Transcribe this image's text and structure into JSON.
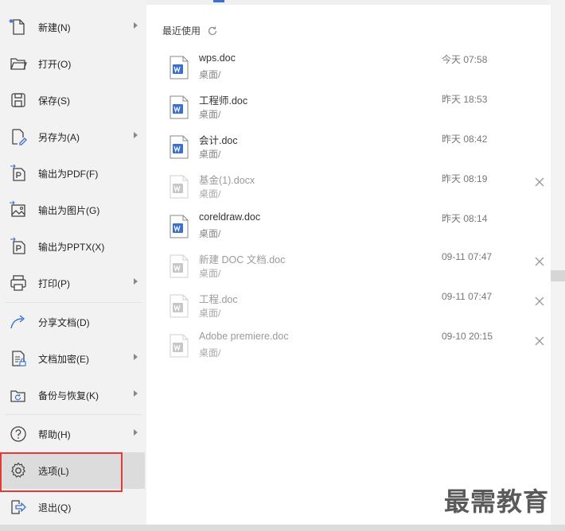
{
  "menu": {
    "items": [
      {
        "label": "新建(N)",
        "icon": "new-file-icon",
        "arrow": true
      },
      {
        "label": "打开(O)",
        "icon": "folder-open-icon",
        "arrow": false
      },
      {
        "label": "保存(S)",
        "icon": "save-icon",
        "arrow": false
      },
      {
        "label": "另存为(A)",
        "icon": "save-as-icon",
        "arrow": true
      },
      {
        "label": "输出为PDF(F)",
        "icon": "export-pdf-icon",
        "arrow": false
      },
      {
        "label": "输出为图片(G)",
        "icon": "export-image-icon",
        "arrow": false
      },
      {
        "label": "输出为PPTX(X)",
        "icon": "export-pptx-icon",
        "arrow": false
      },
      {
        "label": "打印(P)",
        "icon": "print-icon",
        "arrow": true
      },
      {
        "label": "分享文档(D)",
        "icon": "share-icon",
        "arrow": false
      },
      {
        "label": "文档加密(E)",
        "icon": "encrypt-icon",
        "arrow": true
      },
      {
        "label": "备份与恢复(K)",
        "icon": "backup-icon",
        "arrow": true
      },
      {
        "label": "帮助(H)",
        "icon": "help-icon",
        "arrow": true
      },
      {
        "label": "选项(L)",
        "icon": "gear-icon",
        "arrow": false,
        "selected": true
      },
      {
        "label": "退出(Q)",
        "icon": "exit-icon",
        "arrow": false
      }
    ]
  },
  "recent": {
    "title": "最近使用",
    "files": [
      {
        "name": "wps.doc",
        "path": "桌面/",
        "time": "今天 07:58",
        "missing": false
      },
      {
        "name": "工程师.doc",
        "path": "桌面/",
        "time": "昨天 18:53",
        "missing": false
      },
      {
        "name": "会计.doc",
        "path": "桌面/",
        "time": "昨天 08:42",
        "missing": false
      },
      {
        "name": "基金(1).docx",
        "path": "桌面/",
        "time": "昨天 08:19",
        "missing": true
      },
      {
        "name": "coreldraw.doc",
        "path": "桌面/",
        "time": "昨天 08:14",
        "missing": false
      },
      {
        "name": "新建 DOC 文档.doc",
        "path": "桌面/",
        "time": "09-11 07:47",
        "missing": true
      },
      {
        "name": "工程.doc",
        "path": "桌面/",
        "time": "09-11 07:47",
        "missing": true
      },
      {
        "name": "Adobe premiere.doc",
        "path": "桌面/",
        "time": "09-10 20:15",
        "missing": true
      }
    ]
  },
  "watermark": "最需教育",
  "colors": {
    "accent": "#3b6fd0",
    "highlight": "#e53935",
    "menu_bg": "#f2f2f2"
  }
}
